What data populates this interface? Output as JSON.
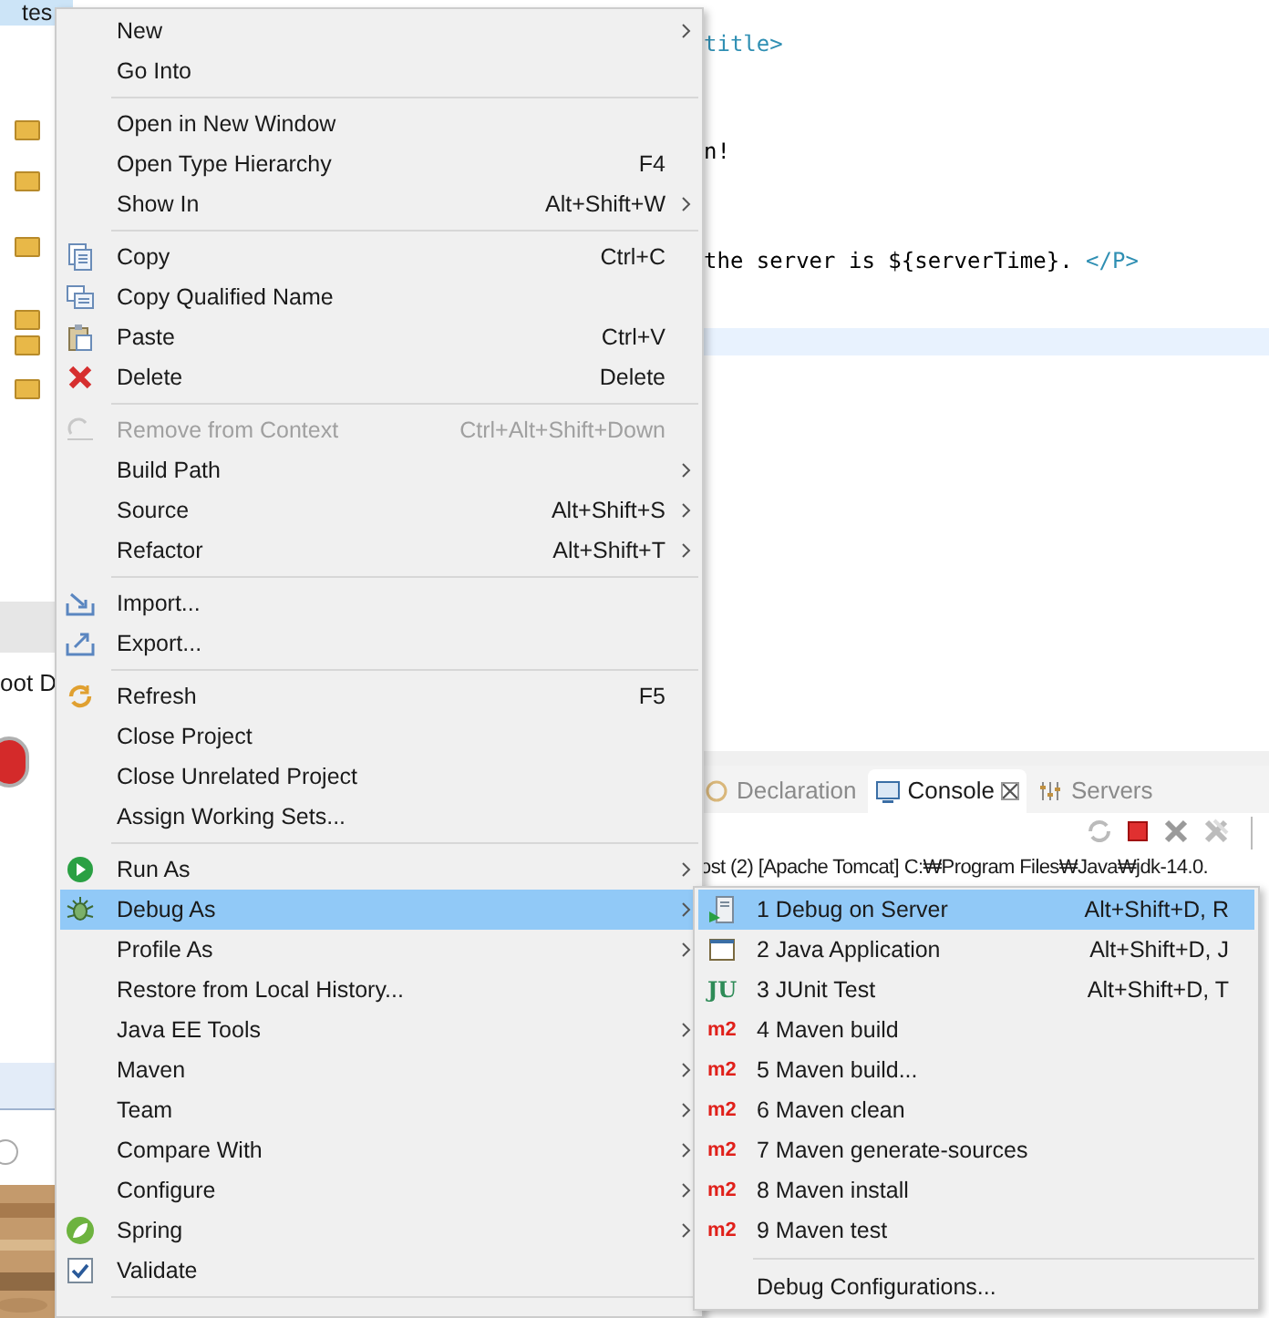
{
  "explorer": {
    "items": [
      {
        "label": "tes",
        "selected": true
      }
    ]
  },
  "dialog": {
    "text": "oot D"
  },
  "editor": {
    "lines": [
      {
        "parts": [
          {
            "text": "title>",
            "kind": "tag"
          }
        ]
      },
      {
        "parts": [
          {
            "text": "n!",
            "kind": "plain"
          }
        ]
      },
      {
        "parts": [
          {
            "text": "the server is ${serverTime}. ",
            "kind": "plain"
          },
          {
            "text": "</P>",
            "kind": "tag"
          }
        ]
      }
    ]
  },
  "console": {
    "tabs": [
      {
        "label": "Declaration",
        "selected": false
      },
      {
        "label": "Console",
        "selected": true
      },
      {
        "label": "Servers",
        "selected": false
      }
    ],
    "line": "ost (2) [Apache Tomcat] C:₩Program Files₩Java₩jdk-14.0."
  },
  "context_menu": {
    "items": [
      {
        "kind": "item",
        "label": "New",
        "submenu": true
      },
      {
        "kind": "item",
        "label": "Go Into"
      },
      {
        "kind": "separator"
      },
      {
        "kind": "item",
        "label": "Open in New Window"
      },
      {
        "kind": "item",
        "label": "Open Type Hierarchy",
        "shortcut": "F4"
      },
      {
        "kind": "item",
        "label": "Show In",
        "shortcut": "Alt+Shift+W",
        "submenu": true
      },
      {
        "kind": "separator"
      },
      {
        "kind": "item",
        "label": "Copy",
        "shortcut": "Ctrl+C"
      },
      {
        "kind": "item",
        "label": "Copy Qualified Name"
      },
      {
        "kind": "item",
        "label": "Paste",
        "shortcut": "Ctrl+V"
      },
      {
        "kind": "item",
        "label": "Delete",
        "shortcut": "Delete"
      },
      {
        "kind": "separator"
      },
      {
        "kind": "item",
        "label": "Remove from Context",
        "shortcut": "Ctrl+Alt+Shift+Down",
        "disabled": true
      },
      {
        "kind": "item",
        "label": "Build Path",
        "submenu": true
      },
      {
        "kind": "item",
        "label": "Source",
        "shortcut": "Alt+Shift+S",
        "submenu": true
      },
      {
        "kind": "item",
        "label": "Refactor",
        "shortcut": "Alt+Shift+T",
        "submenu": true
      },
      {
        "kind": "separator"
      },
      {
        "kind": "item",
        "label": "Import..."
      },
      {
        "kind": "item",
        "label": "Export..."
      },
      {
        "kind": "separator"
      },
      {
        "kind": "item",
        "label": "Refresh",
        "shortcut": "F5"
      },
      {
        "kind": "item",
        "label": "Close Project"
      },
      {
        "kind": "item",
        "label": "Close Unrelated Project"
      },
      {
        "kind": "item",
        "label": "Assign Working Sets..."
      },
      {
        "kind": "separator"
      },
      {
        "kind": "item",
        "label": "Run As",
        "submenu": true
      },
      {
        "kind": "item",
        "label": "Debug As",
        "submenu": true,
        "selected": true
      },
      {
        "kind": "item",
        "label": "Profile As",
        "submenu": true
      },
      {
        "kind": "item",
        "label": "Restore from Local History..."
      },
      {
        "kind": "item",
        "label": "Java EE Tools",
        "submenu": true
      },
      {
        "kind": "item",
        "label": "Maven",
        "submenu": true
      },
      {
        "kind": "item",
        "label": "Team",
        "submenu": true
      },
      {
        "kind": "item",
        "label": "Compare With",
        "submenu": true
      },
      {
        "kind": "item",
        "label": "Configure",
        "submenu": true
      },
      {
        "kind": "item",
        "label": "Spring",
        "submenu": true
      },
      {
        "kind": "item",
        "label": "Validate",
        "checked": true
      },
      {
        "kind": "separator"
      }
    ]
  },
  "submenu": {
    "items": [
      {
        "kind": "item",
        "label": "1 Debug on Server",
        "shortcut": "Alt+Shift+D, R",
        "selected": true
      },
      {
        "kind": "item",
        "label": "2 Java Application",
        "shortcut": "Alt+Shift+D, J",
        "selected": false
      },
      {
        "kind": "item",
        "label": "3 JUnit Test",
        "shortcut": "Alt+Shift+D, T",
        "badge": "JU",
        "selected": false
      },
      {
        "kind": "item",
        "label": "4 Maven build",
        "badge": "m2",
        "selected": false
      },
      {
        "kind": "item",
        "label": "5 Maven build...",
        "badge": "m2",
        "selected": false
      },
      {
        "kind": "item",
        "label": "6 Maven clean",
        "badge": "m2",
        "selected": false
      },
      {
        "kind": "item",
        "label": "7 Maven generate-sources",
        "badge": "m2",
        "selected": false
      },
      {
        "kind": "item",
        "label": "8 Maven install",
        "badge": "m2",
        "selected": false
      },
      {
        "kind": "item",
        "label": "9 Maven test",
        "badge": "m2",
        "selected": false
      },
      {
        "kind": "separator"
      },
      {
        "kind": "item",
        "label": "Debug Configurations...",
        "selected": false
      }
    ]
  }
}
